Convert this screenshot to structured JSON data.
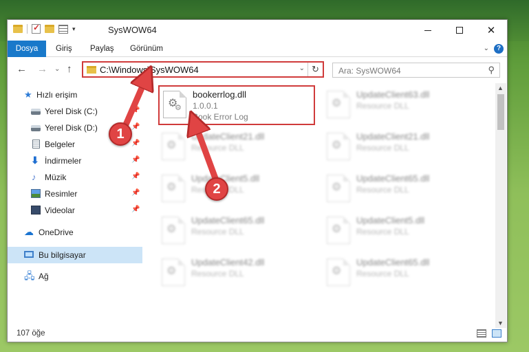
{
  "window": {
    "title": "SysWOW64",
    "controls": {
      "minimize": "—",
      "maximize": "",
      "close": "✕"
    }
  },
  "ribbon": {
    "tabs": [
      "Dosya",
      "Giriş",
      "Paylaş",
      "Görünüm"
    ],
    "help": "?"
  },
  "navigation": {
    "back": "←",
    "forward": "→",
    "up": "↑",
    "address": "C:\\Windows\\SysWOW64",
    "refresh": "↻",
    "search_placeholder": "Ara: SysWOW64",
    "search_icon": "⚲"
  },
  "sidebar": {
    "items": [
      {
        "label": "Hızlı erişim",
        "icon": "star-icon"
      },
      {
        "label": "Yerel Disk (C:)",
        "icon": "drive-icon",
        "pinned": true
      },
      {
        "label": "Yerel Disk (D:)",
        "icon": "drive-icon",
        "pinned": true
      },
      {
        "label": "Belgeler",
        "icon": "document-icon",
        "pinned": true
      },
      {
        "label": "İndirmeler",
        "icon": "download-icon",
        "pinned": true
      },
      {
        "label": "Müzik",
        "icon": "music-icon",
        "pinned": true
      },
      {
        "label": "Resimler",
        "icon": "pictures-icon",
        "pinned": true
      },
      {
        "label": "Videolar",
        "icon": "videos-icon",
        "pinned": true
      },
      {
        "label": "OneDrive",
        "icon": "cloud-icon"
      },
      {
        "label": "Bu bilgisayar",
        "icon": "computer-icon",
        "selected": true
      },
      {
        "label": "Ağ",
        "icon": "network-icon"
      }
    ],
    "pin_glyph": "📌"
  },
  "files": [
    {
      "name": "bookerrlog.dll",
      "line2": "1.0.0.1",
      "line3": "Book Error Log",
      "highlighted": true
    },
    {
      "name": "UpdateClient63.dll",
      "line2": "Resource DLL",
      "blurred": true
    },
    {
      "name": "UpdateClient21.dll",
      "line2": "Resource DLL",
      "blurred": true
    },
    {
      "name": "UpdateClient21.dll",
      "line2": "Resource DLL",
      "blurred": true
    },
    {
      "name": "UpdateClient5.dll",
      "line2": "Resource DLL",
      "blurred": true
    },
    {
      "name": "UpdateClient65.dll",
      "line2": "Resource DLL",
      "blurred": true
    },
    {
      "name": "UpdateClient65.dll",
      "line2": "Resource DLL",
      "blurred": true
    },
    {
      "name": "UpdateClient5.dll",
      "line2": "Resource DLL",
      "blurred": true
    },
    {
      "name": "UpdateClient42.dll",
      "line2": "Resource DLL",
      "blurred": true
    },
    {
      "name": "UpdateClient65.dll",
      "line2": "Resource DLL",
      "blurred": true
    }
  ],
  "status": {
    "count": "107 öğe"
  },
  "annotations": {
    "step1": "1",
    "step2": "2"
  },
  "colors": {
    "accent": "#1979ca",
    "annotation": "#e04444",
    "selected": "#cce4f7"
  }
}
